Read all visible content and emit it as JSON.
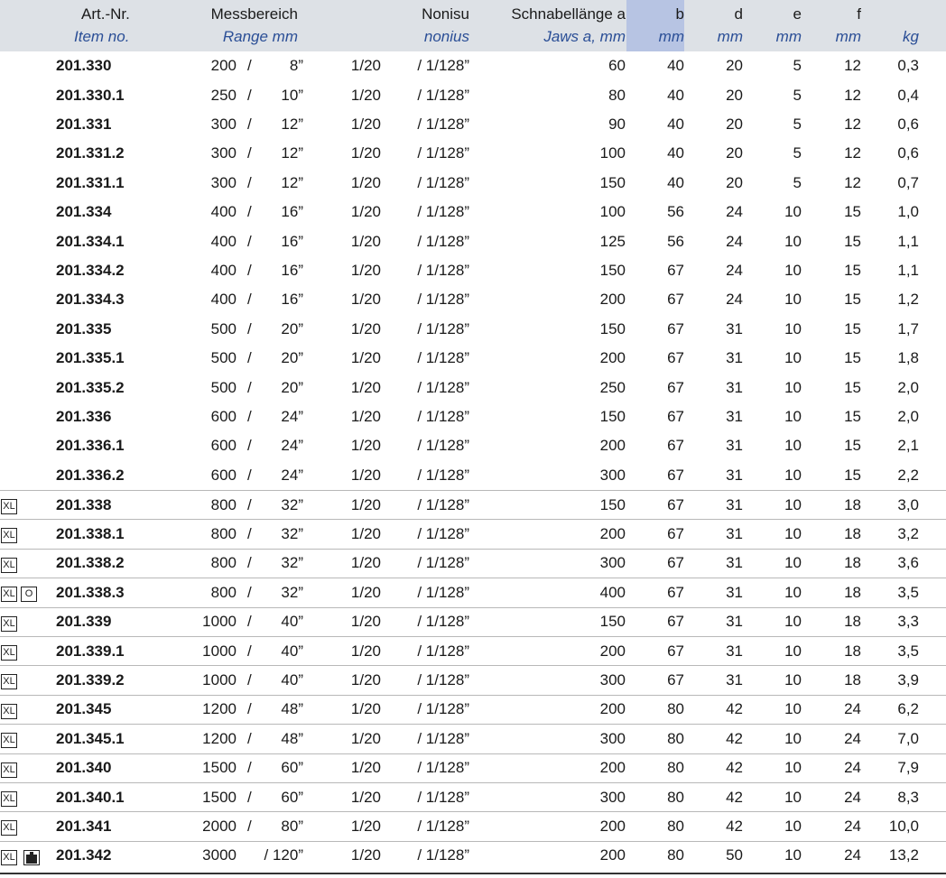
{
  "header": {
    "art": {
      "de": "Art.-Nr.",
      "en": "Item no."
    },
    "range": {
      "de": "Messbereich",
      "en": "Range mm"
    },
    "nonius": {
      "de": "Nonisu",
      "en": "nonius"
    },
    "jaws": {
      "de": "Schnabellänge a",
      "en": "Jaws a, mm"
    },
    "b": {
      "de": "b",
      "en": "mm"
    },
    "d": {
      "de": "d",
      "en": "mm"
    },
    "e": {
      "de": "e",
      "en": "mm"
    },
    "f": {
      "de": "f",
      "en": "mm"
    },
    "kg": {
      "de": "",
      "en": "kg"
    }
  },
  "icons": {
    "xl": "XL",
    "o": "O",
    "weight": "weight-icon"
  },
  "colors": {
    "header_bg": "#dde1e6",
    "highlight_col": "#b7c4e3",
    "italic_text": "#2a4e96"
  },
  "rows": [
    {
      "art": "201.330",
      "mm": "200",
      "inch": "8”",
      "n1": "1/20",
      "n2": "/ 1/128”",
      "a": "60",
      "b": "40",
      "d": "20",
      "e": "5",
      "f": "12",
      "kg": "0,3"
    },
    {
      "art": "201.330.1",
      "mm": "250",
      "inch": "10”",
      "n1": "1/20",
      "n2": "/ 1/128”",
      "a": "80",
      "b": "40",
      "d": "20",
      "e": "5",
      "f": "12",
      "kg": "0,4"
    },
    {
      "art": "201.331",
      "mm": "300",
      "inch": "12”",
      "n1": "1/20",
      "n2": "/ 1/128”",
      "a": "90",
      "b": "40",
      "d": "20",
      "e": "5",
      "f": "12",
      "kg": "0,6"
    },
    {
      "art": "201.331.2",
      "mm": "300",
      "inch": "12”",
      "n1": "1/20",
      "n2": "/ 1/128”",
      "a": "100",
      "b": "40",
      "d": "20",
      "e": "5",
      "f": "12",
      "kg": "0,6"
    },
    {
      "art": "201.331.1",
      "mm": "300",
      "inch": "12”",
      "n1": "1/20",
      "n2": "/ 1/128”",
      "a": "150",
      "b": "40",
      "d": "20",
      "e": "5",
      "f": "12",
      "kg": "0,7"
    },
    {
      "art": "201.334",
      "mm": "400",
      "inch": "16”",
      "n1": "1/20",
      "n2": "/ 1/128”",
      "a": "100",
      "b": "56",
      "d": "24",
      "e": "10",
      "f": "15",
      "kg": "1,0"
    },
    {
      "art": "201.334.1",
      "mm": "400",
      "inch": "16”",
      "n1": "1/20",
      "n2": "/ 1/128”",
      "a": "125",
      "b": "56",
      "d": "24",
      "e": "10",
      "f": "15",
      "kg": "1,1"
    },
    {
      "art": "201.334.2",
      "mm": "400",
      "inch": "16”",
      "n1": "1/20",
      "n2": "/ 1/128”",
      "a": "150",
      "b": "67",
      "d": "24",
      "e": "10",
      "f": "15",
      "kg": "1,1"
    },
    {
      "art": "201.334.3",
      "mm": "400",
      "inch": "16”",
      "n1": "1/20",
      "n2": "/ 1/128”",
      "a": "200",
      "b": "67",
      "d": "24",
      "e": "10",
      "f": "15",
      "kg": "1,2"
    },
    {
      "art": "201.335",
      "mm": "500",
      "inch": "20”",
      "n1": "1/20",
      "n2": "/ 1/128”",
      "a": "150",
      "b": "67",
      "d": "31",
      "e": "10",
      "f": "15",
      "kg": "1,7"
    },
    {
      "art": "201.335.1",
      "mm": "500",
      "inch": "20”",
      "n1": "1/20",
      "n2": "/ 1/128”",
      "a": "200",
      "b": "67",
      "d": "31",
      "e": "10",
      "f": "15",
      "kg": "1,8"
    },
    {
      "art": "201.335.2",
      "mm": "500",
      "inch": "20”",
      "n1": "1/20",
      "n2": "/ 1/128”",
      "a": "250",
      "b": "67",
      "d": "31",
      "e": "10",
      "f": "15",
      "kg": "2,0"
    },
    {
      "art": "201.336",
      "mm": "600",
      "inch": "24”",
      "n1": "1/20",
      "n2": "/ 1/128”",
      "a": "150",
      "b": "67",
      "d": "31",
      "e": "10",
      "f": "15",
      "kg": "2,0"
    },
    {
      "art": "201.336.1",
      "mm": "600",
      "inch": "24”",
      "n1": "1/20",
      "n2": "/ 1/128”",
      "a": "200",
      "b": "67",
      "d": "31",
      "e": "10",
      "f": "15",
      "kg": "2,1"
    },
    {
      "art": "201.336.2",
      "mm": "600",
      "inch": "24”",
      "n1": "1/20",
      "n2": "/ 1/128”",
      "a": "300",
      "b": "67",
      "d": "31",
      "e": "10",
      "f": "15",
      "kg": "2,2"
    },
    {
      "art": "201.338",
      "mm": "800",
      "inch": "32”",
      "n1": "1/20",
      "n2": "/ 1/128”",
      "a": "150",
      "b": "67",
      "d": "31",
      "e": "10",
      "f": "18",
      "kg": "3,0",
      "xl": true
    },
    {
      "art": "201.338.1",
      "mm": "800",
      "inch": "32”",
      "n1": "1/20",
      "n2": "/ 1/128”",
      "a": "200",
      "b": "67",
      "d": "31",
      "e": "10",
      "f": "18",
      "kg": "3,2",
      "xl": true
    },
    {
      "art": "201.338.2",
      "mm": "800",
      "inch": "32”",
      "n1": "1/20",
      "n2": "/ 1/128”",
      "a": "300",
      "b": "67",
      "d": "31",
      "e": "10",
      "f": "18",
      "kg": "3,6",
      "xl": true
    },
    {
      "art": "201.338.3",
      "mm": "800",
      "inch": "32”",
      "n1": "1/20",
      "n2": "/ 1/128”",
      "a": "400",
      "b": "67",
      "d": "31",
      "e": "10",
      "f": "18",
      "kg": "3,5",
      "xl": true,
      "o": true
    },
    {
      "art": "201.339",
      "mm": "1000",
      "inch": "40”",
      "n1": "1/20",
      "n2": "/ 1/128”",
      "a": "150",
      "b": "67",
      "d": "31",
      "e": "10",
      "f": "18",
      "kg": "3,3",
      "xl": true
    },
    {
      "art": "201.339.1",
      "mm": "1000",
      "inch": "40”",
      "n1": "1/20",
      "n2": "/ 1/128”",
      "a": "200",
      "b": "67",
      "d": "31",
      "e": "10",
      "f": "18",
      "kg": "3,5",
      "xl": true
    },
    {
      "art": "201.339.2",
      "mm": "1000",
      "inch": "40”",
      "n1": "1/20",
      "n2": "/ 1/128”",
      "a": "300",
      "b": "67",
      "d": "31",
      "e": "10",
      "f": "18",
      "kg": "3,9",
      "xl": true
    },
    {
      "art": "201.345",
      "mm": "1200",
      "inch": "48”",
      "n1": "1/20",
      "n2": "/ 1/128”",
      "a": "200",
      "b": "80",
      "d": "42",
      "e": "10",
      "f": "24",
      "kg": "6,2",
      "xl": true
    },
    {
      "art": "201.345.1",
      "mm": "1200",
      "inch": "48”",
      "n1": "1/20",
      "n2": "/ 1/128”",
      "a": "300",
      "b": "80",
      "d": "42",
      "e": "10",
      "f": "24",
      "kg": "7,0",
      "xl": true
    },
    {
      "art": "201.340",
      "mm": "1500",
      "inch": "60”",
      "n1": "1/20",
      "n2": "/ 1/128”",
      "a": "200",
      "b": "80",
      "d": "42",
      "e": "10",
      "f": "24",
      "kg": "7,9",
      "xl": true
    },
    {
      "art": "201.340.1",
      "mm": "1500",
      "inch": "60”",
      "n1": "1/20",
      "n2": "/ 1/128”",
      "a": "300",
      "b": "80",
      "d": "42",
      "e": "10",
      "f": "24",
      "kg": "8,3",
      "xl": true
    },
    {
      "art": "201.341",
      "mm": "2000",
      "inch": "80”",
      "n1": "1/20",
      "n2": "/ 1/128”",
      "a": "200",
      "b": "80",
      "d": "42",
      "e": "10",
      "f": "24",
      "kg": "10,0",
      "xl": true
    },
    {
      "art": "201.342",
      "mm": "3000",
      "inch": "/ 120”",
      "n1": "1/20",
      "n2": "/ 1/128”",
      "a": "200",
      "b": "80",
      "d": "50",
      "e": "10",
      "f": "24",
      "kg": "13,2",
      "xl": true,
      "weight": true
    }
  ]
}
